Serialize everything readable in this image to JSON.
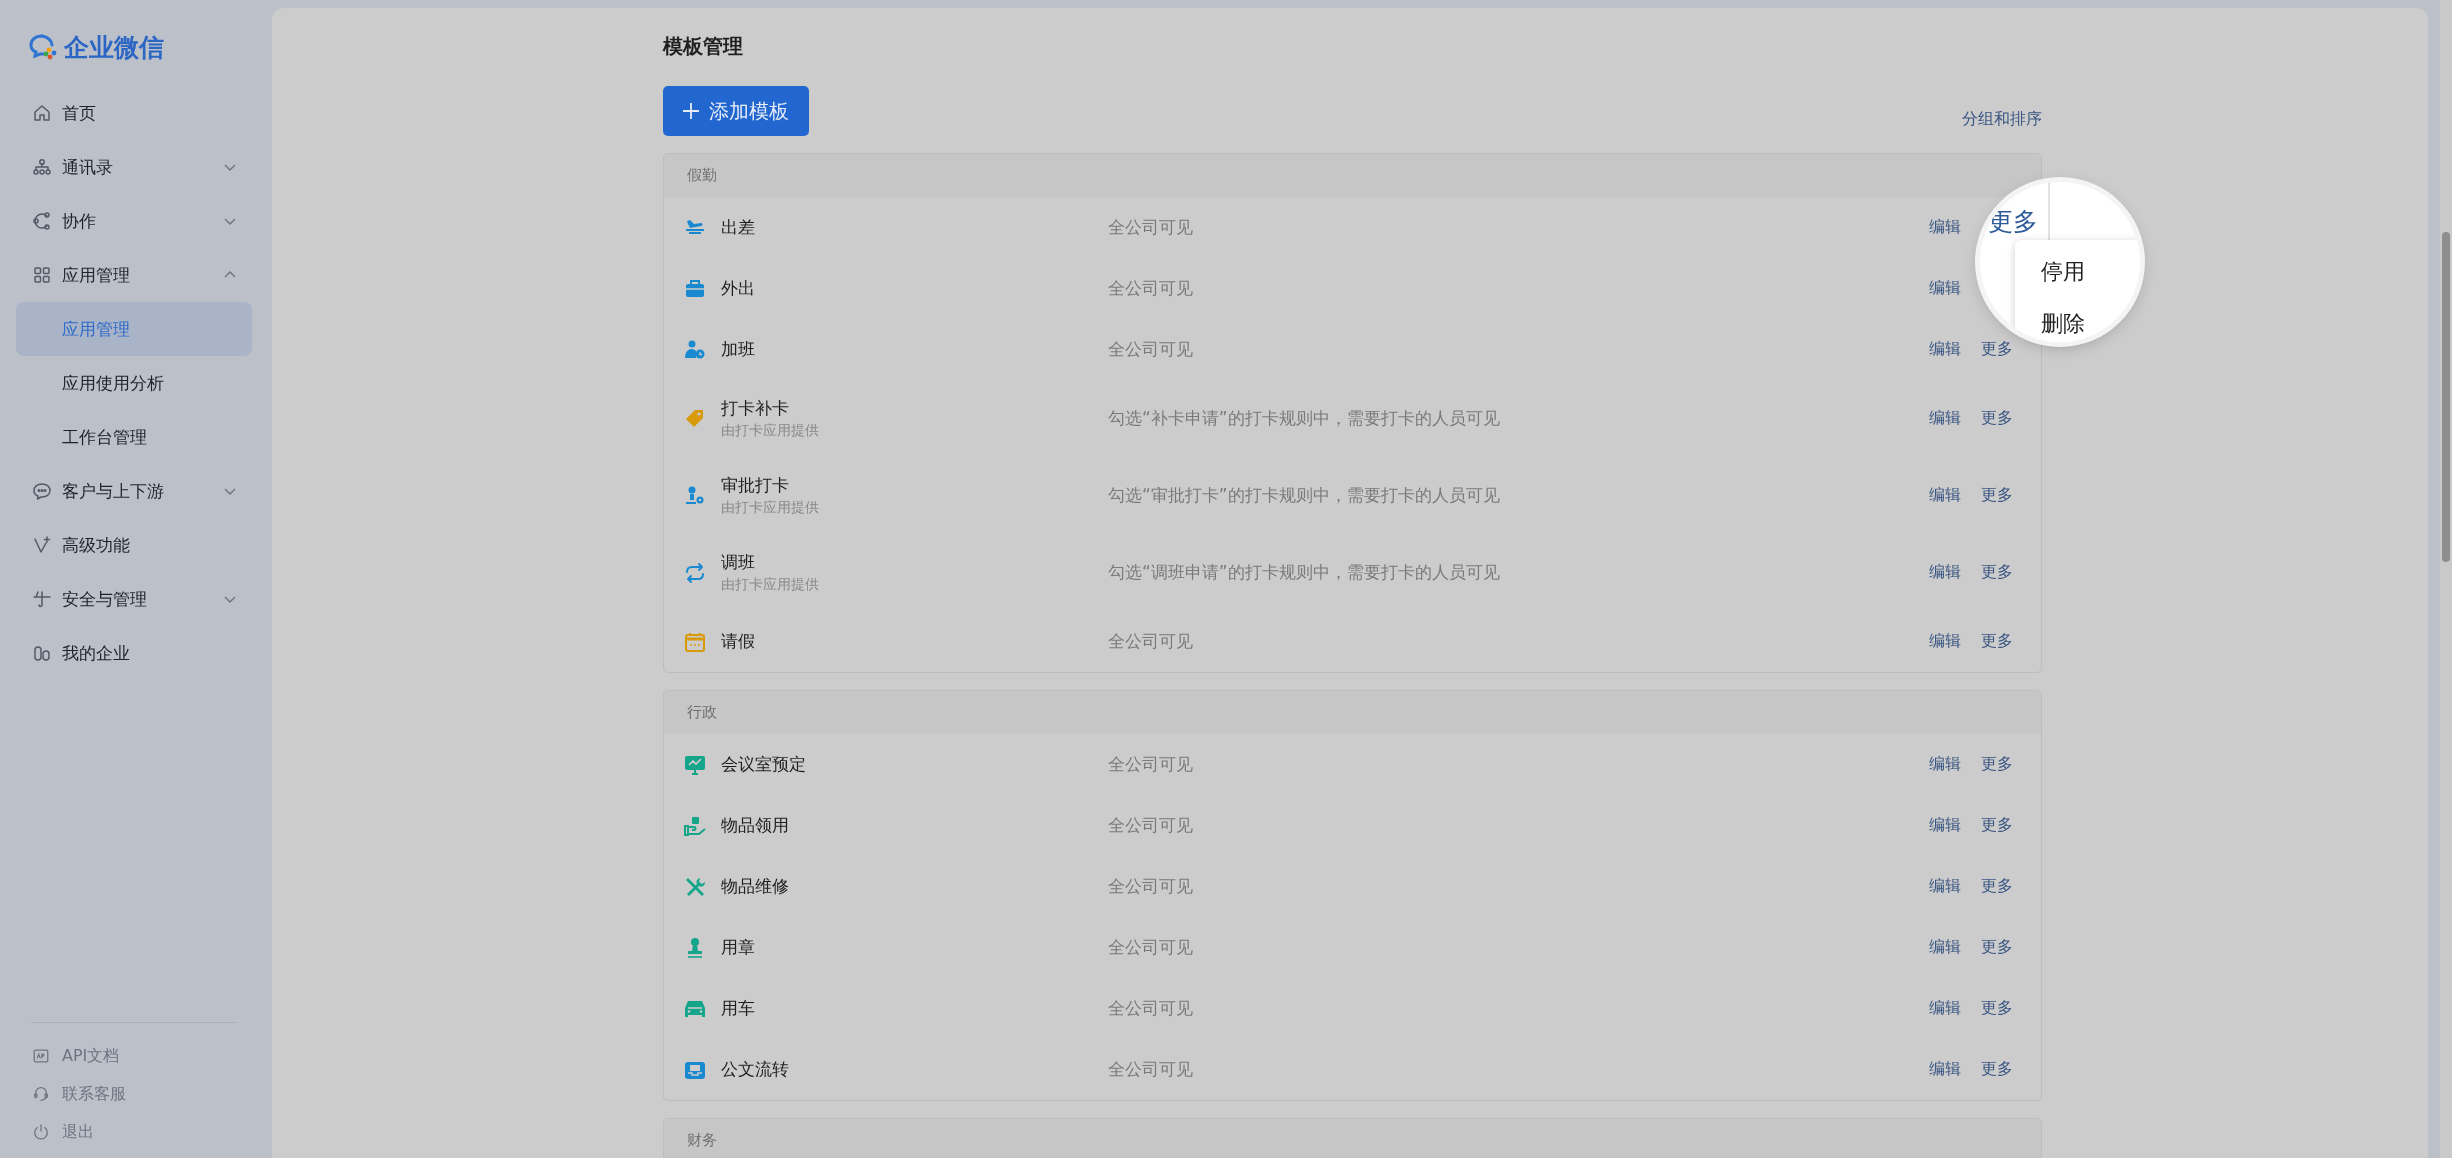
{
  "sidebar": {
    "logo": "企业微信",
    "nav": [
      {
        "label": "首页"
      },
      {
        "label": "通讯录",
        "expanded": false
      },
      {
        "label": "协作",
        "expanded": false
      },
      {
        "label": "应用管理",
        "expanded": true,
        "children": [
          {
            "label": "应用管理",
            "selected": true
          },
          {
            "label": "应用使用分析",
            "selected": false
          },
          {
            "label": "工作台管理",
            "selected": false
          }
        ]
      },
      {
        "label": "客户与上下游",
        "expanded": false
      },
      {
        "label": "高级功能"
      },
      {
        "label": "安全与管理",
        "expanded": false
      },
      {
        "label": "我的企业"
      }
    ],
    "footer": [
      "API文档",
      "联系客服",
      "退出"
    ]
  },
  "page": {
    "title": "模板管理",
    "add_button": "添加模板",
    "group_sort_link": "分组和排序",
    "groups": [
      {
        "name": "假勤",
        "rows": [
          {
            "name": "出差",
            "visibility": "全公司可见",
            "edit": "编辑"
          },
          {
            "name": "外出",
            "visibility": "全公司可见",
            "edit": "编辑"
          },
          {
            "name": "加班",
            "visibility": "全公司可见",
            "edit": "编辑",
            "more": "更多"
          },
          {
            "name": "打卡补卡",
            "provider": "由打卡应用提供",
            "visibility": "勾选“补卡申请”的打卡规则中，需要打卡的人员可见",
            "edit": "编辑",
            "more": "更多"
          },
          {
            "name": "审批打卡",
            "provider": "由打卡应用提供",
            "visibility": "勾选“审批打卡”的打卡规则中，需要打卡的人员可见",
            "edit": "编辑",
            "more": "更多"
          },
          {
            "name": "调班",
            "provider": "由打卡应用提供",
            "visibility": "勾选“调班申请”的打卡规则中，需要打卡的人员可见",
            "edit": "编辑",
            "more": "更多"
          },
          {
            "name": "请假",
            "visibility": "全公司可见",
            "edit": "编辑",
            "more": "更多"
          }
        ]
      },
      {
        "name": "行政",
        "rows": [
          {
            "name": "会议室预定",
            "visibility": "全公司可见",
            "edit": "编辑",
            "more": "更多"
          },
          {
            "name": "物品领用",
            "visibility": "全公司可见",
            "edit": "编辑",
            "more": "更多"
          },
          {
            "name": "物品维修",
            "visibility": "全公司可见",
            "edit": "编辑",
            "more": "更多"
          },
          {
            "name": "用章",
            "visibility": "全公司可见",
            "edit": "编辑",
            "more": "更多"
          },
          {
            "name": "用车",
            "visibility": "全公司可见",
            "edit": "编辑",
            "more": "更多"
          },
          {
            "name": "公文流转",
            "visibility": "全公司可见",
            "edit": "编辑",
            "more": "更多"
          }
        ]
      },
      {
        "name": "财务"
      }
    ]
  },
  "magnifier": {
    "more": "更多",
    "menu": [
      "停用",
      "删除"
    ]
  }
}
